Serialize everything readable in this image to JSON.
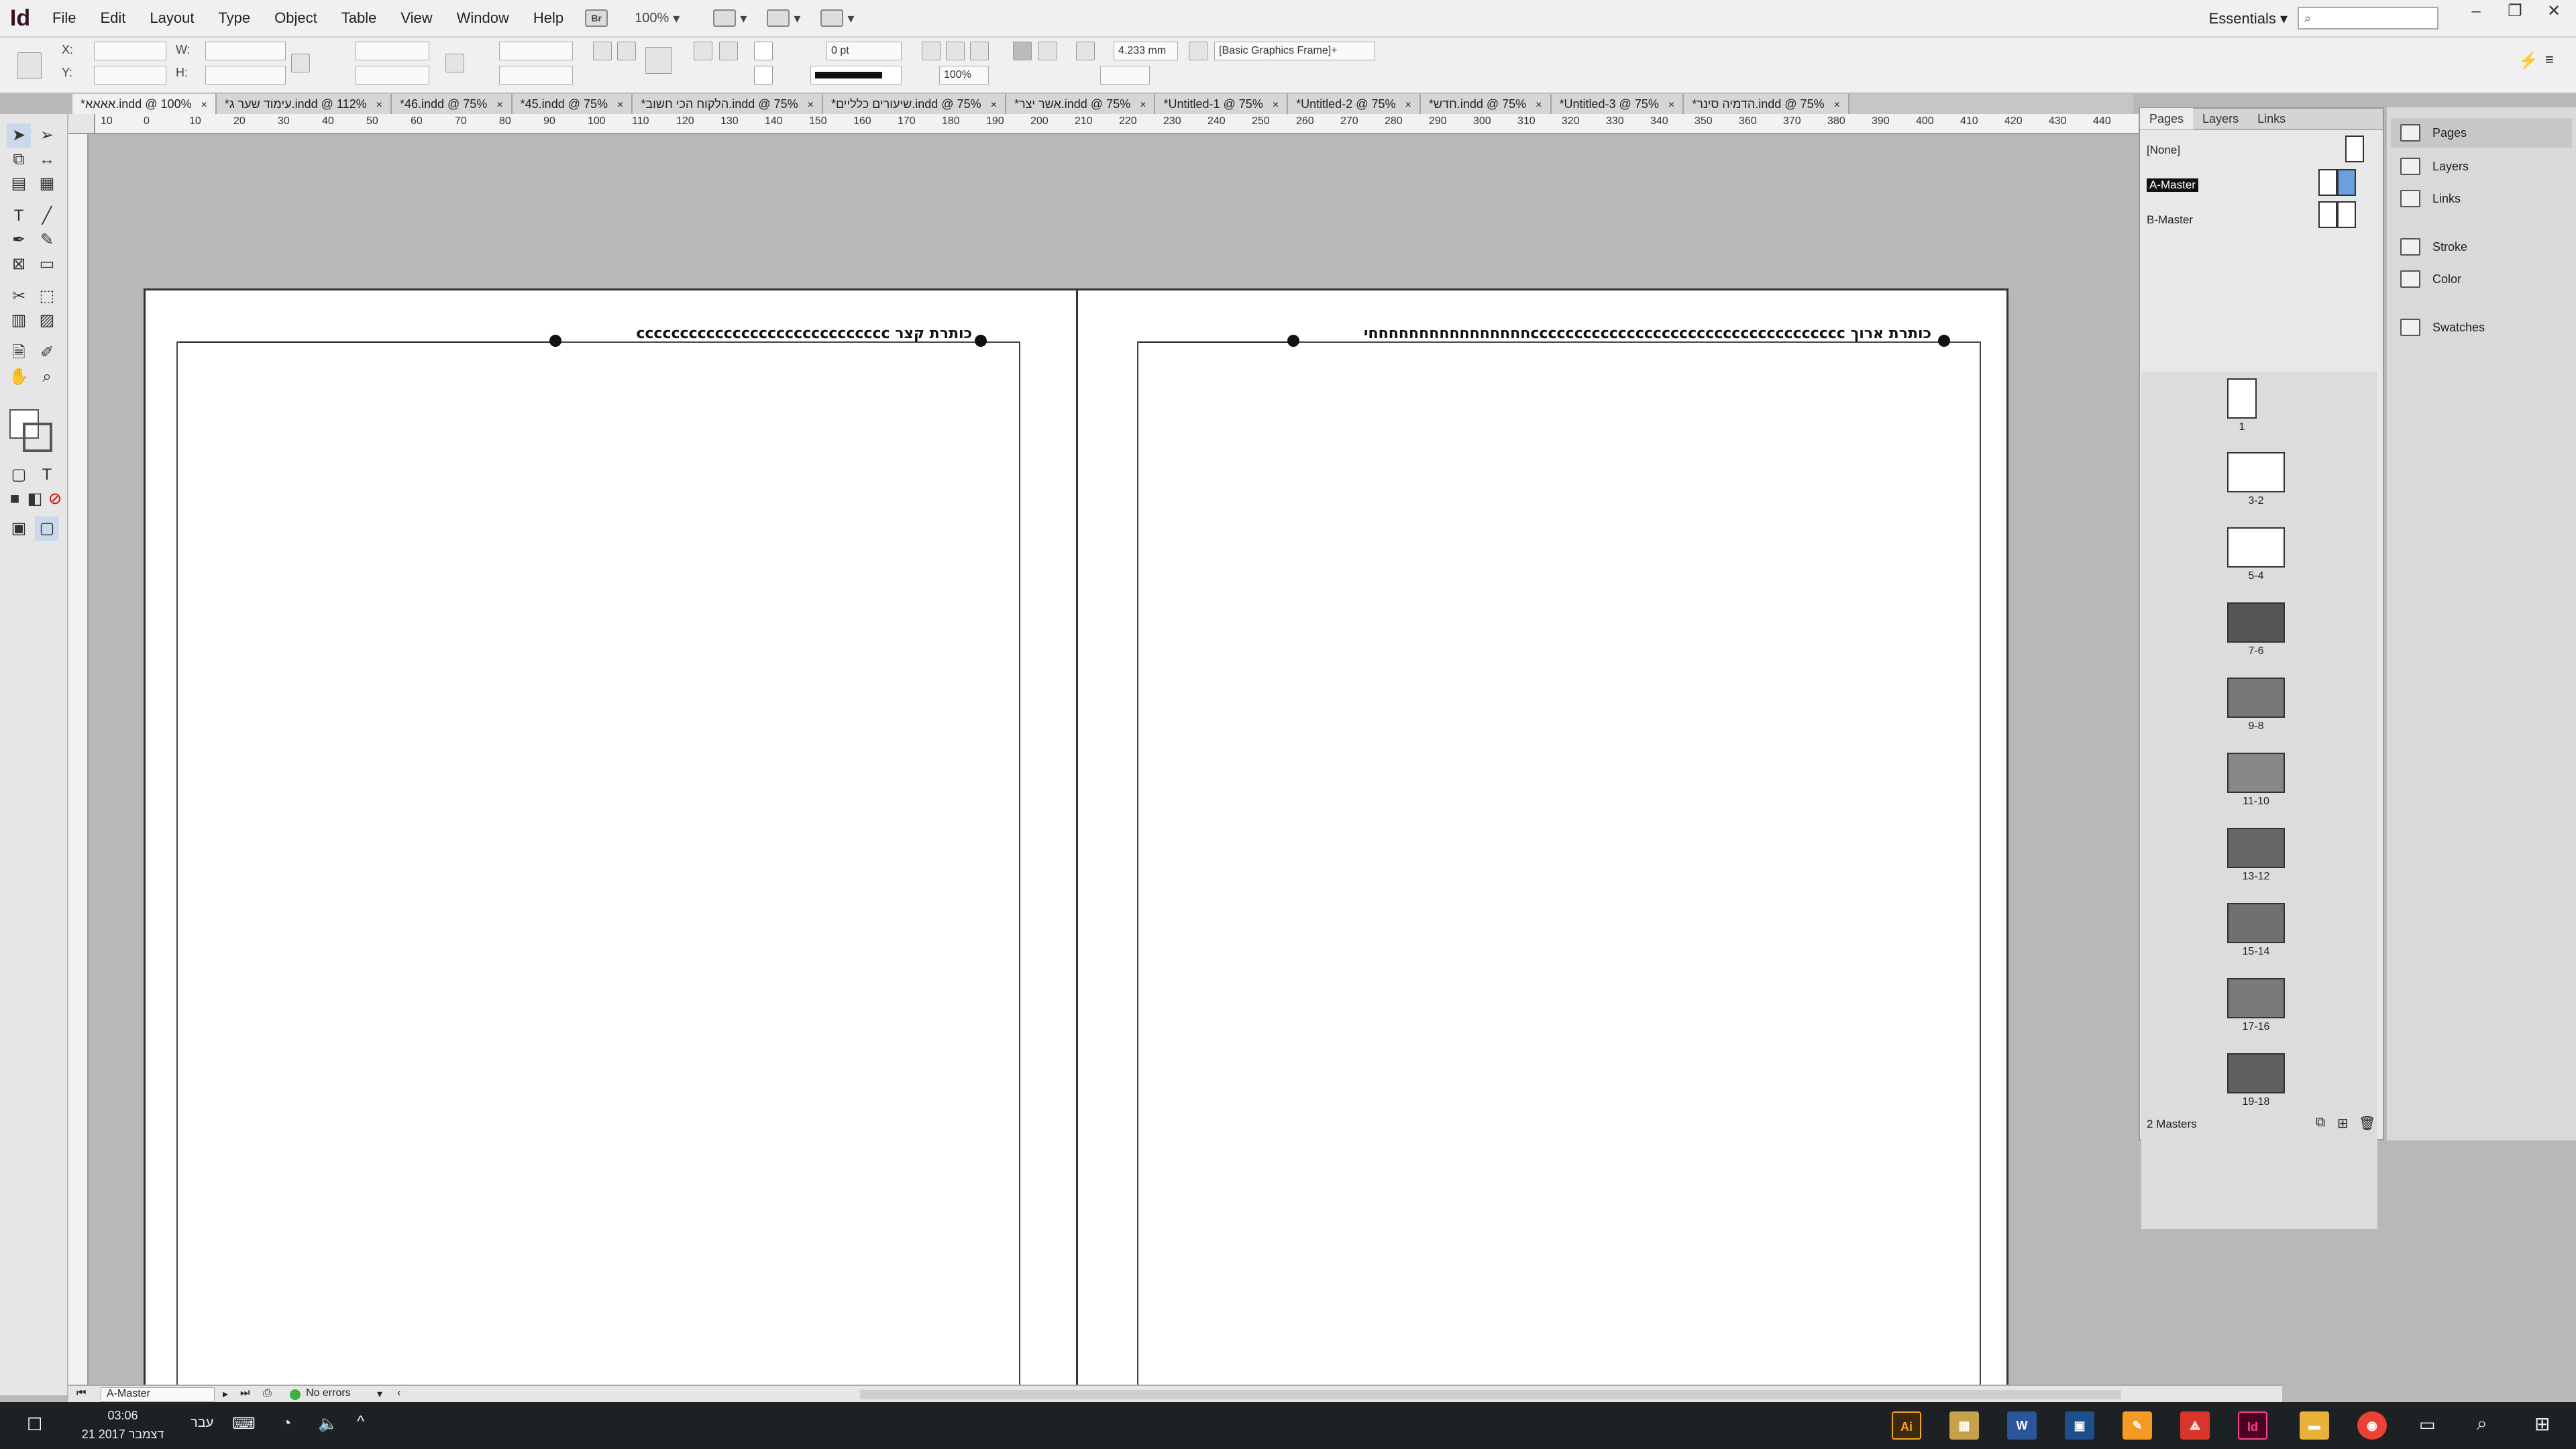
{
  "app": {
    "logo": "Id"
  },
  "menu": [
    "File",
    "Edit",
    "Layout",
    "Type",
    "Object",
    "Table",
    "View",
    "Window",
    "Help"
  ],
  "menubar": {
    "bridge": "Br",
    "zoom": "100%",
    "workspace": "Essentials"
  },
  "control": {
    "x_label": "X:",
    "y_label": "Y:",
    "w_label": "W:",
    "h_label": "H:",
    "stroke_weight": "0 pt",
    "scale": "100%",
    "dimension": "4.233 mm",
    "object_style": "[Basic Graphics Frame]+"
  },
  "tabs": [
    {
      "label": "*אאאא.indd @ 100%",
      "active": true
    },
    {
      "label": "*עימוד שער ג.indd @ 112%"
    },
    {
      "label": "*46.indd @ 75%"
    },
    {
      "label": "*45.indd @ 75%"
    },
    {
      "label": "*הלקוח הכי חשוב.indd @ 75%"
    },
    {
      "label": "*שיעורים כלליים.indd @ 75%"
    },
    {
      "label": "*אשר יצר.indd @ 75%"
    },
    {
      "label": "*Untitled-1 @ 75%"
    },
    {
      "label": "*Untitled-2 @ 75%"
    },
    {
      "label": "*חדש.indd @ 75%"
    },
    {
      "label": "*Untitled-3 @ 75%"
    },
    {
      "label": "*הדמיה סינר.indd @ 75%"
    }
  ],
  "ruler": [
    "10",
    "0",
    "10",
    "20",
    "30",
    "40",
    "50",
    "60",
    "70",
    "80",
    "90",
    "100",
    "110",
    "120",
    "130",
    "140",
    "150",
    "160",
    "170",
    "180",
    "190",
    "200",
    "210",
    "220",
    "230",
    "240",
    "250",
    "260",
    "270",
    "280",
    "290",
    "300",
    "310",
    "320",
    "330",
    "340",
    "350",
    "360",
    "370",
    "380",
    "390",
    "400",
    "410",
    "420",
    "430",
    "440"
  ],
  "spread": {
    "left_header": "כותרת קצר  ccccccccccccccccccccccccccccc",
    "right_header": "כותרת ארוך ccccccccccccccccccccccccccccccccccccחחחחחחחחחחחחחחחחי"
  },
  "pages_panel": {
    "tabs": [
      "Pages",
      "Layers",
      "Links"
    ],
    "masters": [
      "[None]",
      "A-Master",
      "B-Master"
    ],
    "thumbs": [
      "1",
      "3-2",
      "5-4",
      "7-6",
      "9-8",
      "11-10",
      "13-12",
      "15-14",
      "17-16",
      "19-18"
    ],
    "footer": "2 Masters"
  },
  "collapsed_panels": [
    "Pages",
    "Layers",
    "Links",
    "Stroke",
    "Color",
    "Swatches"
  ],
  "status": {
    "master": "A-Master",
    "preflight": "No errors"
  },
  "taskbar": {
    "time": "03:06",
    "date": "21 דצמבר 2017",
    "lang": "עבר"
  }
}
